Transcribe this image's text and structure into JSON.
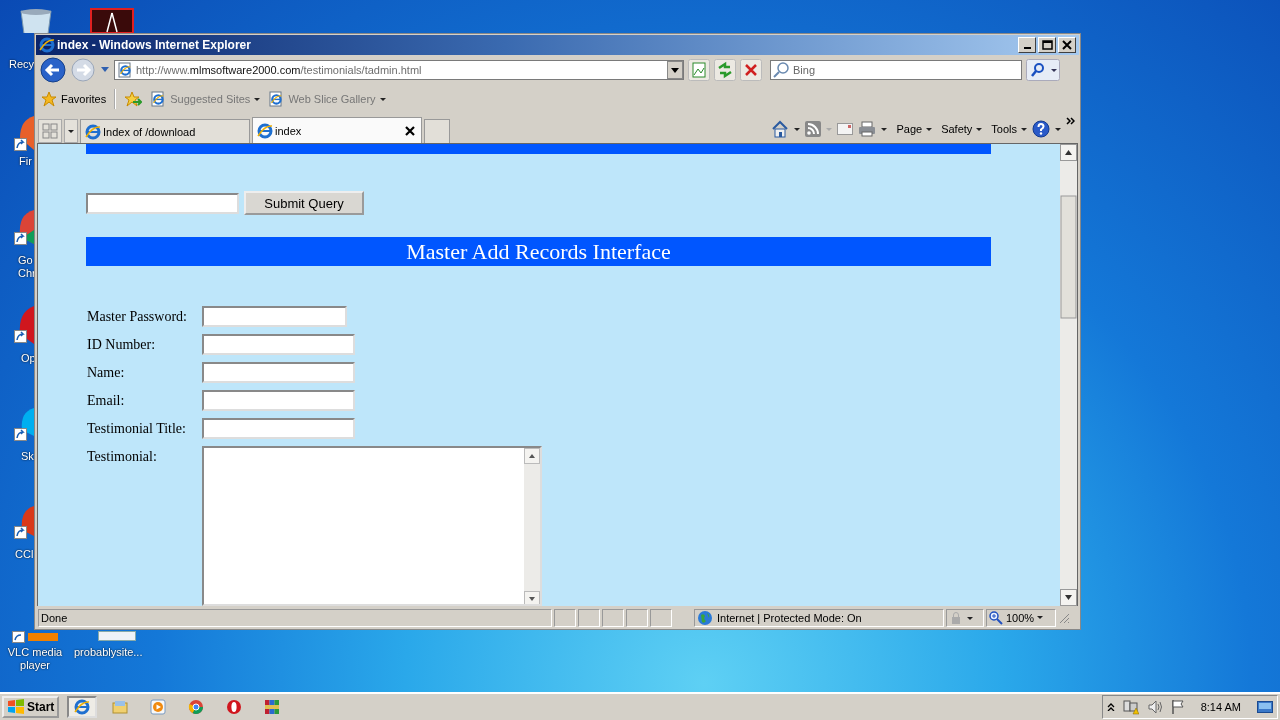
{
  "desktop": {
    "icons": [
      {
        "label": "Recy",
        "kind": "bin"
      },
      {
        "kind": "acrobat"
      },
      {
        "label": "Fir",
        "kind": "firefox"
      },
      {
        "label": "Go Chr",
        "kind": "chrome"
      },
      {
        "label": "Op",
        "kind": "opera"
      },
      {
        "label": "Sk",
        "kind": "skype"
      },
      {
        "label": "CCl",
        "kind": "ccleaner"
      },
      {
        "label": "VLC media player",
        "kind": "vlc"
      },
      {
        "label": "probablysite...",
        "kind": "file"
      }
    ]
  },
  "window": {
    "title": "index - Windows Internet Explorer"
  },
  "address_bar": {
    "prefix": "http://www.",
    "domain": "mlmsoftware2000.com",
    "path": "/testimonials/tadmin.html"
  },
  "search": {
    "placeholder": "Bing"
  },
  "favorites_bar": {
    "label": "Favorites",
    "links": [
      "Suggested Sites",
      "Web Slice Gallery"
    ]
  },
  "tabs": [
    {
      "label": "Index of /download",
      "selected": false
    },
    {
      "label": "index",
      "selected": true
    }
  ],
  "command_bar": [
    "Page",
    "Safety",
    "Tools"
  ],
  "page": {
    "search_section": {
      "button": "Submit Query"
    },
    "add_section": {
      "heading": "Master Add Records Interface",
      "fields": [
        {
          "label": "Master Password:",
          "kind": "input"
        },
        {
          "label": "ID Number:",
          "kind": "input"
        },
        {
          "label": "Name:",
          "kind": "input"
        },
        {
          "label": "Email:",
          "kind": "input"
        },
        {
          "label": "Testimonial Title:",
          "kind": "input"
        },
        {
          "label": "Testimonial:",
          "kind": "textarea"
        }
      ]
    }
  },
  "status_bar": {
    "text": "Done",
    "zone": "Internet | Protected Mode: On",
    "zoom": "100%"
  },
  "taskbar": {
    "start": "Start",
    "apps": [
      {
        "kind": "ie",
        "selected": true
      },
      {
        "kind": "explorer",
        "selected": false
      },
      {
        "kind": "media",
        "selected": false
      },
      {
        "kind": "chrome",
        "selected": false
      },
      {
        "kind": "opera",
        "selected": false
      },
      {
        "kind": "winrar",
        "selected": false
      }
    ],
    "clock": "8:14 AM"
  }
}
